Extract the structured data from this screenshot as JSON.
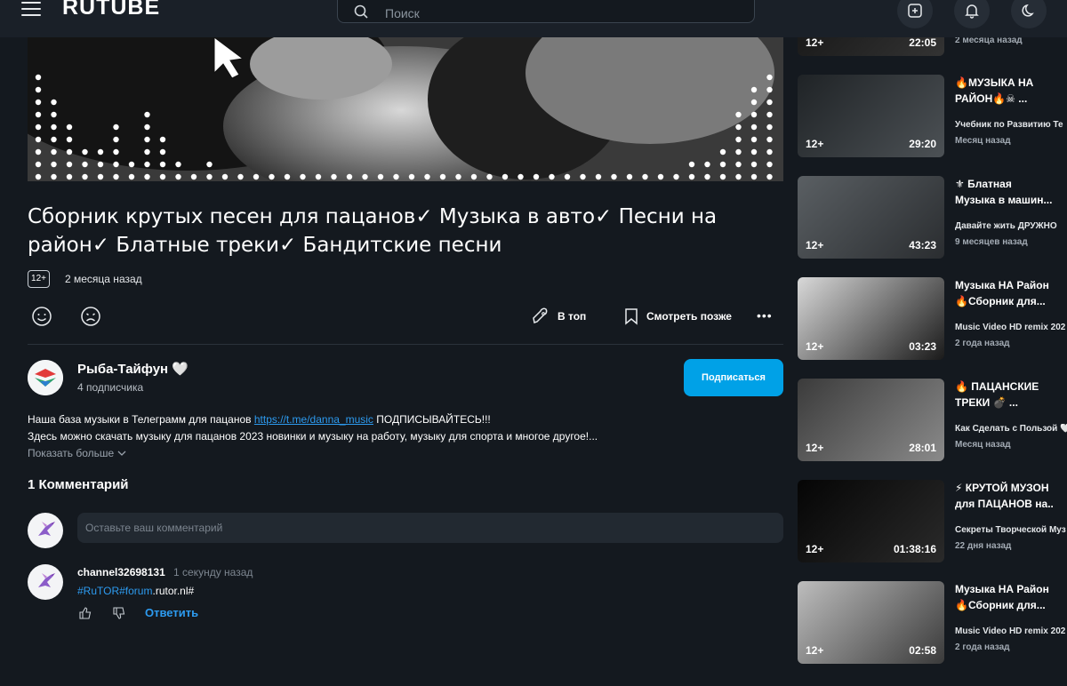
{
  "header": {
    "logo": "RUTUBE",
    "search_placeholder": "Поиск"
  },
  "video": {
    "title": "Сборник крутых песен для пацанов✓ Музыка в авто✓ Песни на район✓ Блатные треки✓ Бандитские песни",
    "age_rating": "12+",
    "date": "2 месяца назад",
    "actions": {
      "top": "В топ",
      "watch_later": "Смотреть позже",
      "more": "•••"
    }
  },
  "channel": {
    "name": "Рыба-Тайфун 🤍",
    "subscribers": "4 подписчика",
    "subscribe_label": "Подписаться"
  },
  "description": {
    "line1_prefix": "Наша база музыки в Телеграмм для пацанов ",
    "link": "https://t.me/danna_music",
    "line1_suffix": " ПОДПИСЫВАЙТЕСЬ!!!",
    "line2": "Здесь можно скачать музыку для пацанов 2023 новинки и музыку на работу, музыку для спорта и многое другое!...",
    "show_more": "Показать больше"
  },
  "comments": {
    "heading": "1 Комментарий",
    "input_placeholder": "Оставьте ваш комментарий",
    "items": [
      {
        "author": "channel32698131",
        "time": "1 секунду назад",
        "text_tag": "#RuTOR#forum",
        "text_rest": ".rutor.nl#",
        "reply": "Ответить"
      }
    ]
  },
  "recommendations": [
    {
      "title1": "",
      "title2": "",
      "channel": "",
      "date": "2 месяца назад",
      "badge": "12+",
      "duration": "22:05"
    },
    {
      "title1": "🔥МУЗЫКА НА",
      "title2": "РАЙОН🔥☠ ...",
      "channel": "Учебник по Развитию Те",
      "date": "Месяц назад",
      "badge": "12+",
      "duration": "29:20"
    },
    {
      "title1": "⚜ Блатная",
      "title2": "Музыка в машин...",
      "channel": "Давайте жить ДРУЖНО",
      "date": "9 месяцев назад",
      "badge": "12+",
      "duration": "43:23"
    },
    {
      "title1": "Музыка НА Район",
      "title2": "🔥Сборник для...",
      "channel": "Music Video HD remix 202",
      "date": "2 года назад",
      "badge": "12+",
      "duration": "03:23"
    },
    {
      "title1": "🔥 ПАЦАНСКИЕ",
      "title2": "ТРЕКИ 💣 ...",
      "channel": "Как Сделать с Пользой 🤍",
      "date": "Месяц назад",
      "badge": "12+",
      "duration": "28:01"
    },
    {
      "title1": "⚡ КРУТОЙ МУЗОН",
      "title2": "для ПАЦАНОВ на...",
      "channel": "Секреты Творческой Муз",
      "date": "22 дня назад",
      "badge": "12+",
      "duration": "01:38:16"
    },
    {
      "title1": "Музыка НА Район",
      "title2": "🔥Сборник для...",
      "channel": "Music Video HD remix 202",
      "date": "2 года назад",
      "badge": "12+",
      "duration": "02:58"
    }
  ]
}
